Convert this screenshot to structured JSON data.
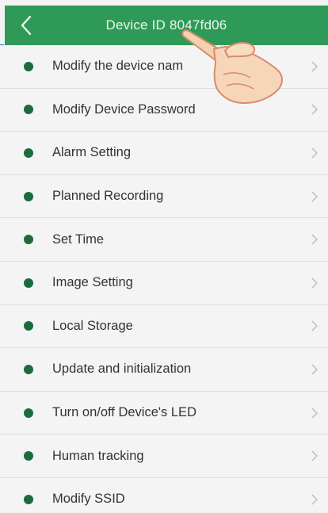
{
  "header": {
    "title": "Device ID 8047fd06",
    "back_icon": "chevron-left-icon"
  },
  "menu": {
    "items": [
      {
        "label": "Modify the device nam"
      },
      {
        "label": "Modify Device Password"
      },
      {
        "label": "Alarm Setting"
      },
      {
        "label": "Planned Recording"
      },
      {
        "label": "Set Time"
      },
      {
        "label": "Image Setting"
      },
      {
        "label": "Local Storage"
      },
      {
        "label": "Update and initialization"
      },
      {
        "label": "Turn on/off Device's LED"
      },
      {
        "label": "Human tracking"
      },
      {
        "label": "Modify SSID"
      }
    ]
  },
  "colors": {
    "header_bg": "#2f9a57",
    "bullet": "#1d6b3b",
    "list_bg": "#f4f4f4"
  }
}
